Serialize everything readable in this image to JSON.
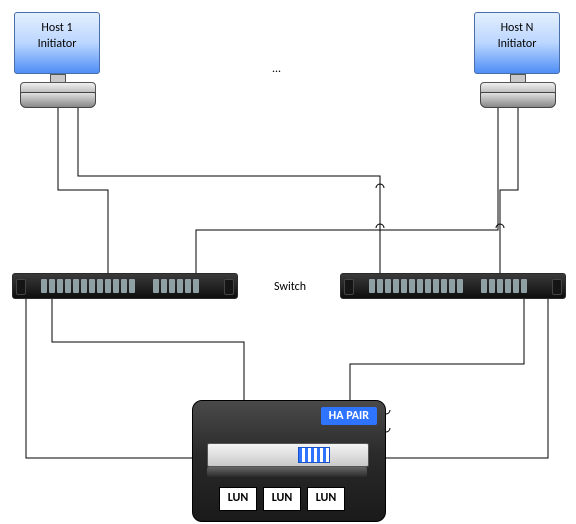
{
  "diagram": {
    "hosts": [
      {
        "line1": "Host 1",
        "line2": "Initiator"
      },
      {
        "line1": "Host N",
        "line2": "Initiator"
      }
    ],
    "ellipsis": "...",
    "switch_label": "Switch",
    "ha_pair_label": "HA PAIR",
    "luns": [
      "LUN",
      "LUN",
      "LUN"
    ]
  },
  "colors": {
    "ha_blue": "#2f74ff",
    "line": "#000000"
  }
}
